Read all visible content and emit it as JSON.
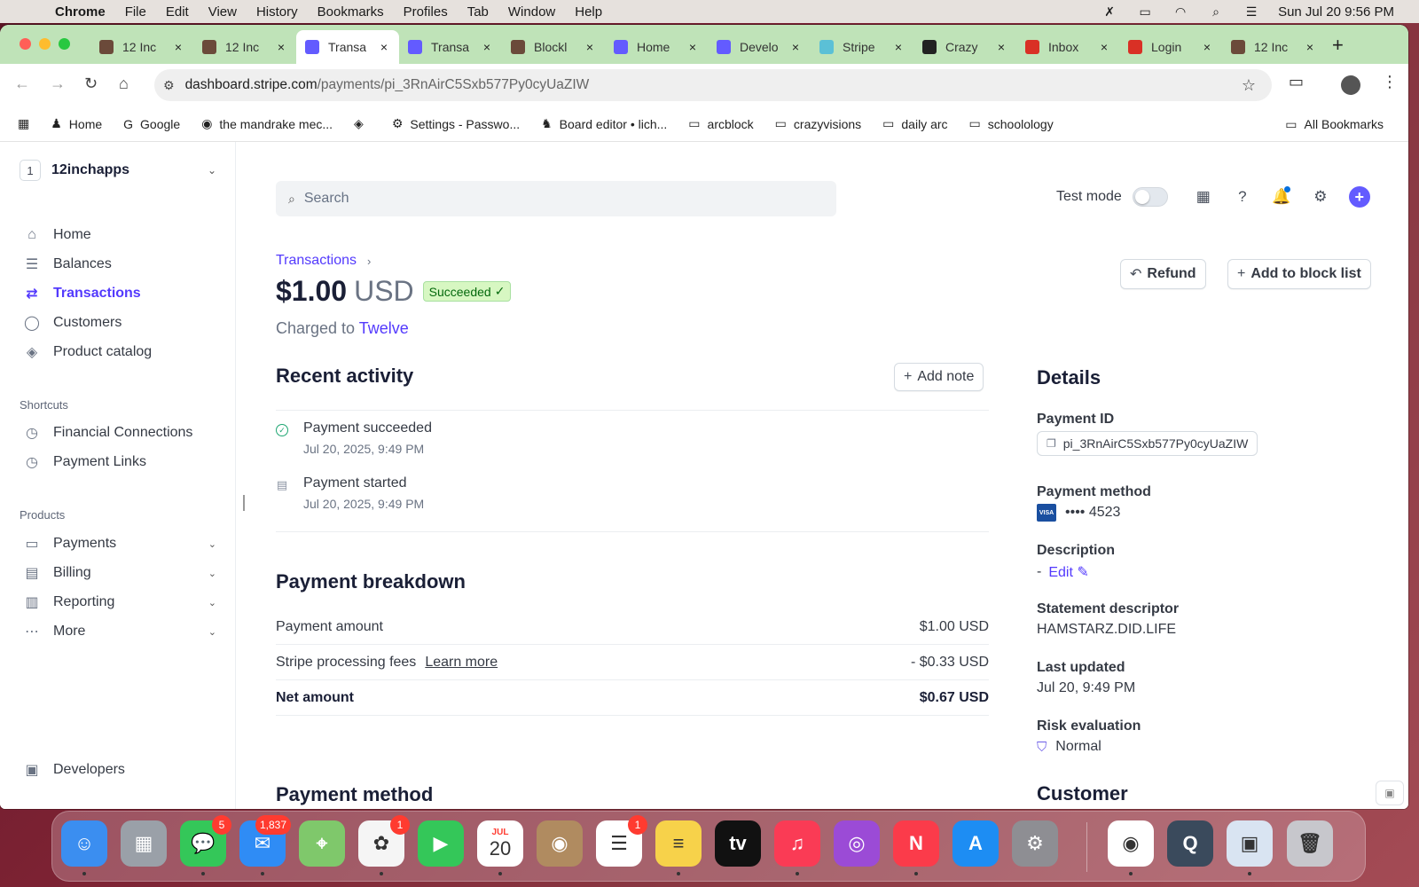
{
  "menubar": {
    "app_name": "Chrome",
    "items": [
      "File",
      "Edit",
      "View",
      "History",
      "Bookmarks",
      "Profiles",
      "Tab",
      "Window",
      "Help"
    ],
    "datetime": "Sun Jul 20  9:56 PM"
  },
  "tabs": [
    {
      "label": "12 Inc",
      "favicon": "12inch-icon",
      "color": "#6b4a3a"
    },
    {
      "label": "12 Inc",
      "favicon": "12inch-icon",
      "color": "#6b4a3a"
    },
    {
      "label": "Transa",
      "favicon": "stripe-icon",
      "color": "#635bff",
      "active": true
    },
    {
      "label": "Transa",
      "favicon": "stripe-icon",
      "color": "#635bff"
    },
    {
      "label": "Blockl",
      "favicon": "12inch-icon",
      "color": "#6b4a3a"
    },
    {
      "label": "Home",
      "favicon": "stripe-icon",
      "color": "#635bff"
    },
    {
      "label": "Develo",
      "favicon": "stripe-icon",
      "color": "#635bff"
    },
    {
      "label": "Stripe",
      "favicon": "react-icon",
      "color": "#5bc0d6"
    },
    {
      "label": "Crazy",
      "favicon": "openai-icon",
      "color": "#222222"
    },
    {
      "label": "Inbox",
      "favicon": "gmail-icon",
      "color": "#d93025"
    },
    {
      "label": "Login",
      "favicon": "gmail-icon",
      "color": "#d93025"
    },
    {
      "label": "12 Inc",
      "favicon": "12inch-icon",
      "color": "#6b4a3a"
    }
  ],
  "address_bar": {
    "host": "dashboard.stripe.com",
    "path": "/payments/pi_3RnAirC5Sxb577Py0cyUaZIW"
  },
  "bookmarks": [
    {
      "label": "Home",
      "icon": "person-icon"
    },
    {
      "label": "Google",
      "icon": "google-icon"
    },
    {
      "label": "the mandrake mec...",
      "icon": "duckduckgo-icon"
    },
    {
      "label": "",
      "icon": "tag-icon"
    },
    {
      "label": "Settings - Passwo...",
      "icon": "gear-icon"
    },
    {
      "label": "Board editor • lich...",
      "icon": "lichess-icon"
    },
    {
      "label": "arcblock",
      "icon": "folder-icon"
    },
    {
      "label": "crazyvisions",
      "icon": "folder-icon"
    },
    {
      "label": "daily arc",
      "icon": "folder-icon"
    },
    {
      "label": "schoolology",
      "icon": "folder-icon"
    }
  ],
  "all_bookmarks": "All Bookmarks",
  "sidebar": {
    "account_badge": "1",
    "account_name": "12inchapps",
    "nav": [
      {
        "label": "Home",
        "icon": "home-icon"
      },
      {
        "label": "Balances",
        "icon": "balances-icon"
      },
      {
        "label": "Transactions",
        "icon": "transactions-icon",
        "active": true
      },
      {
        "label": "Customers",
        "icon": "customers-icon"
      },
      {
        "label": "Product catalog",
        "icon": "box-icon"
      }
    ],
    "shortcuts_title": "Shortcuts",
    "shortcuts": [
      {
        "label": "Financial Connections",
        "icon": "clock-icon"
      },
      {
        "label": "Payment Links",
        "icon": "clock-icon"
      }
    ],
    "products_title": "Products",
    "products": [
      {
        "label": "Payments",
        "icon": "wallet-icon"
      },
      {
        "label": "Billing",
        "icon": "billing-icon"
      },
      {
        "label": "Reporting",
        "icon": "chart-icon"
      },
      {
        "label": "More",
        "icon": "more-icon"
      }
    ],
    "developers": "Developers"
  },
  "header": {
    "search_placeholder": "Search",
    "test_mode_label": "Test mode"
  },
  "payment": {
    "breadcrumb": "Transactions",
    "amount": "$1.00",
    "currency": "USD",
    "status": "Succeeded",
    "charged_prefix": "Charged to",
    "charged_to": "Twelve",
    "refund_label": "Refund",
    "block_label": "Add to block list"
  },
  "activity": {
    "title": "Recent activity",
    "add_note": "Add note",
    "events": [
      {
        "title": "Payment succeeded",
        "date": "Jul 20, 2025, 9:49 PM"
      },
      {
        "title": "Payment started",
        "date": "Jul 20, 2025, 9:49 PM"
      }
    ]
  },
  "breakdown": {
    "title": "Payment breakdown",
    "rows": [
      {
        "label": "Payment amount",
        "value": "$1.00 USD"
      },
      {
        "label": "Stripe processing fees",
        "link": "Learn more",
        "value": "- $0.33 USD"
      },
      {
        "label": "Net amount",
        "value": "$0.67 USD"
      }
    ]
  },
  "payment_method_section_title": "Payment method",
  "details": {
    "title": "Details",
    "payment_id_label": "Payment ID",
    "payment_id": "pi_3RnAirC5Sxb577Py0cyUaZIW",
    "payment_method_label": "Payment method",
    "card_brand": "VISA",
    "card_last4": "•••• 4523",
    "description_label": "Description",
    "description_value": "-",
    "edit_label": "Edit",
    "statement_label": "Statement descriptor",
    "statement_value": "HAMSTARZ.DID.LIFE",
    "updated_label": "Last updated",
    "updated_value": "Jul 20, 9:49 PM",
    "risk_label": "Risk evaluation",
    "risk_value": "Normal",
    "customer_title": "Customer"
  },
  "dock": {
    "apps": [
      {
        "name": "finder-icon",
        "color": "#3b8ef0",
        "glyph": "☺"
      },
      {
        "name": "launchpad-icon",
        "color": "#9aa0a8",
        "glyph": "▦"
      },
      {
        "name": "messages-icon",
        "color": "#34c759",
        "glyph": "💬",
        "badge": "5"
      },
      {
        "name": "mail-icon",
        "color": "#2f8cf5",
        "glyph": "✉",
        "badge": "1,837"
      },
      {
        "name": "maps-icon",
        "color": "#7fc86b",
        "glyph": "⌖"
      },
      {
        "name": "photos-icon",
        "color": "#f5f5f5",
        "glyph": "✿",
        "badge": "1"
      },
      {
        "name": "facetime-icon",
        "color": "#34c759",
        "glyph": "▶"
      },
      {
        "name": "calendar-icon",
        "color": "#ffffff",
        "glyph": "20",
        "month": "JUL"
      },
      {
        "name": "contacts-icon",
        "color": "#b08b60",
        "glyph": "◉"
      },
      {
        "name": "reminders-icon",
        "color": "#ffffff",
        "glyph": "☰",
        "badge": "1"
      },
      {
        "name": "notes-icon",
        "color": "#f7d24a",
        "glyph": "≡"
      },
      {
        "name": "appletv-icon",
        "color": "#111111",
        "glyph": "tv"
      },
      {
        "name": "music-icon",
        "color": "#fa3b55",
        "glyph": "♫"
      },
      {
        "name": "podcasts-icon",
        "color": "#9b4bd6",
        "glyph": "◎"
      },
      {
        "name": "news-icon",
        "color": "#fb3b4a",
        "glyph": "N"
      },
      {
        "name": "appstore-icon",
        "color": "#1d8df3",
        "glyph": "A"
      },
      {
        "name": "settings-icon",
        "color": "#8e8e93",
        "glyph": "⚙"
      },
      {
        "name": "chrome-icon",
        "color": "#ffffff",
        "glyph": "◉"
      },
      {
        "name": "quicktime-icon",
        "color": "#3a4a5c",
        "glyph": "Q"
      },
      {
        "name": "preview-icon",
        "color": "#d9e4f2",
        "glyph": "▣"
      },
      {
        "name": "trash-icon",
        "color": "#c7c7cc",
        "glyph": "🗑"
      }
    ]
  }
}
